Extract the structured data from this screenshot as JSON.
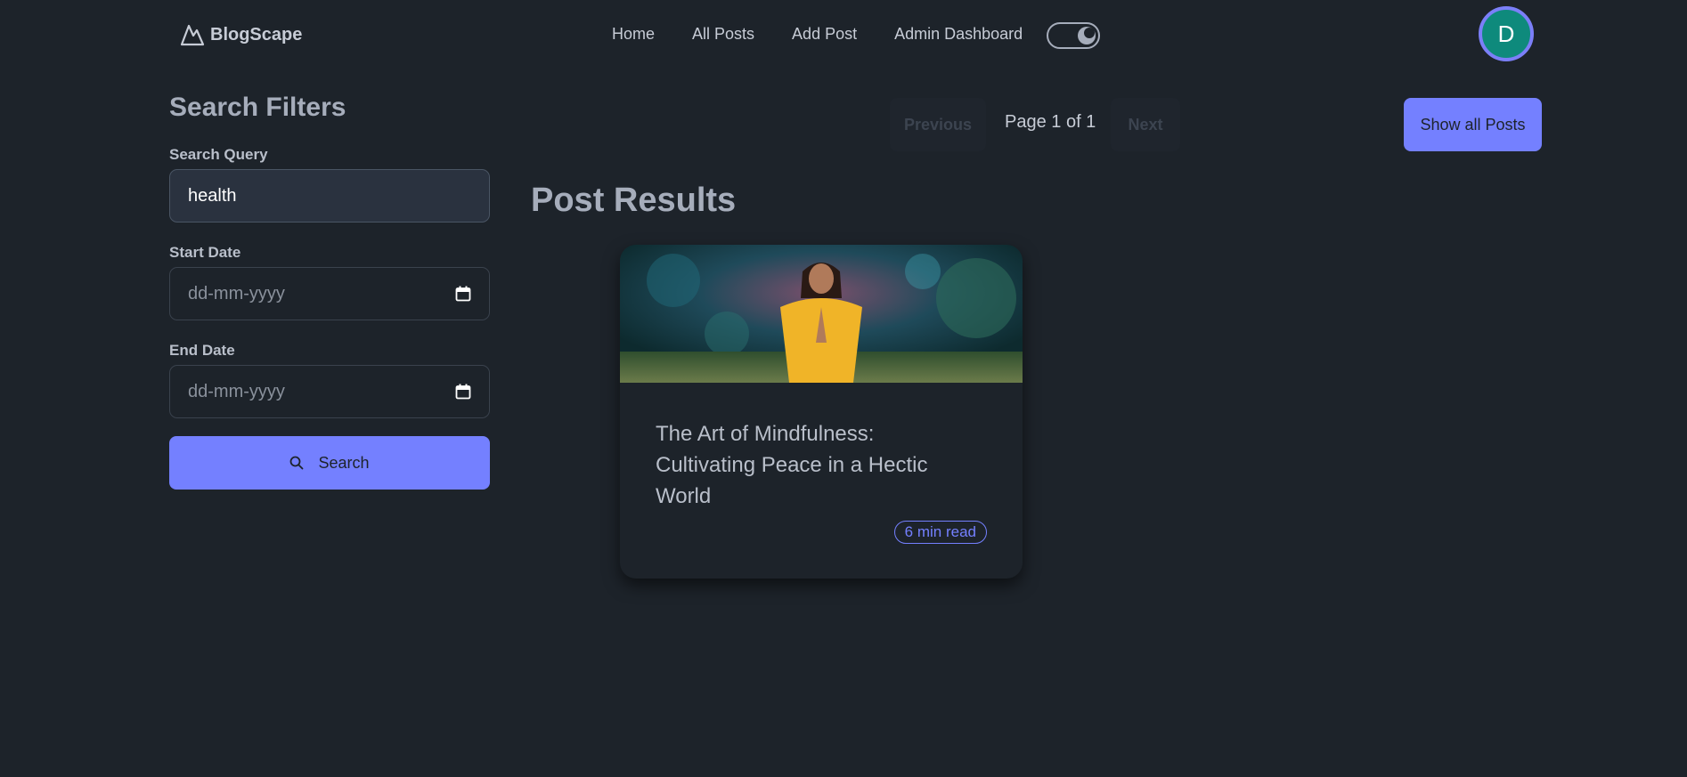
{
  "navbar": {
    "brand": "BlogScape",
    "links": [
      "Home",
      "All Posts",
      "Add Post",
      "Admin Dashboard"
    ],
    "avatar_initial": "D"
  },
  "filters": {
    "title": "Search Filters",
    "query_label": "Search Query",
    "query_value": "health",
    "start_label": "Start Date",
    "start_placeholder": "dd-mm-yyyy",
    "end_label": "End Date",
    "end_placeholder": "dd-mm-yyyy",
    "search_button": "Search"
  },
  "pagination": {
    "previous": "Previous",
    "page_info": "Page 1 of 1",
    "next": "Next",
    "show_all": "Show all Posts"
  },
  "results": {
    "title": "Post Results",
    "posts": [
      {
        "title": "The Art of Mindfulness: Cultivating Peace in a Hectic World",
        "read_time": "6 min read"
      }
    ]
  },
  "colors": {
    "background": "#1d232a",
    "primary": "#7480ff",
    "avatar": "#0e8a7c"
  }
}
